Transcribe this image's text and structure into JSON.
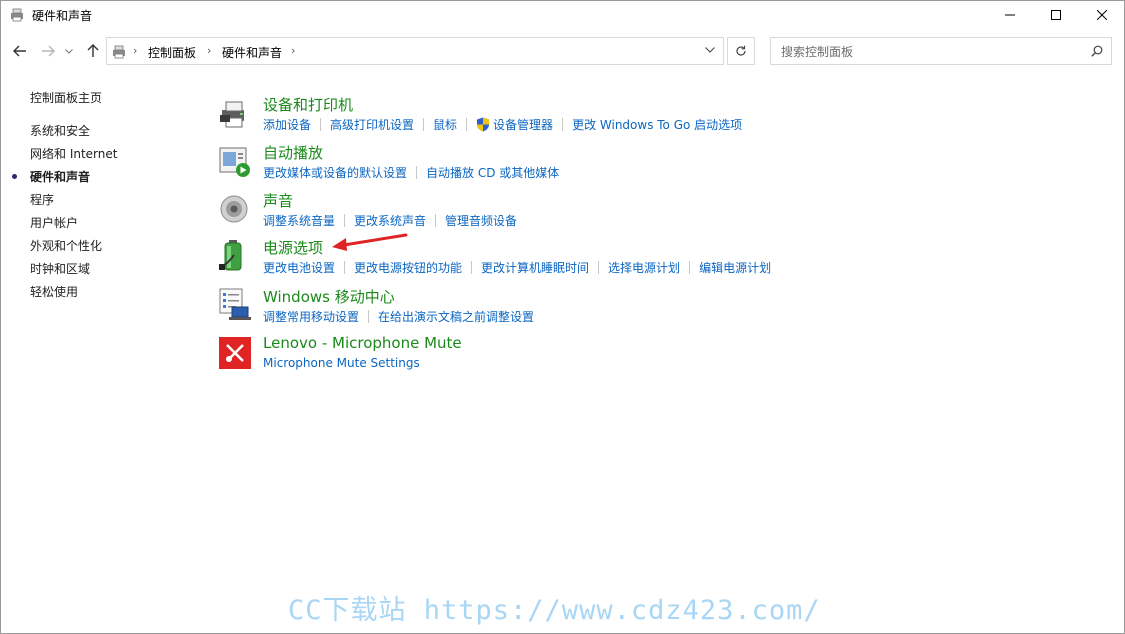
{
  "window": {
    "title": "硬件和声音",
    "controls": {
      "minimize": "minimize",
      "maximize": "maximize",
      "close": "close"
    }
  },
  "address_bar": {
    "crumbs": [
      "控制面板",
      "硬件和声音"
    ]
  },
  "search": {
    "placeholder": "搜索控制面板"
  },
  "left_nav": {
    "items": [
      {
        "label": "控制面板主页"
      },
      {
        "label": "系统和安全"
      },
      {
        "label": "网络和 Internet"
      },
      {
        "label": "硬件和声音",
        "active": true
      },
      {
        "label": "程序"
      },
      {
        "label": "用户帐户"
      },
      {
        "label": "外观和个性化"
      },
      {
        "label": "时钟和区域"
      },
      {
        "label": "轻松使用"
      }
    ]
  },
  "categories": [
    {
      "title": "设备和打印机",
      "icon": "printer-icon",
      "links": [
        "添加设备",
        "高级打印机设置",
        "鼠标",
        "设备管理器",
        "更改 Windows To Go 启动选项"
      ]
    },
    {
      "title": "自动播放",
      "icon": "autoplay-icon",
      "links": [
        "更改媒体或设备的默认设置",
        "自动播放 CD 或其他媒体"
      ]
    },
    {
      "title": "声音",
      "icon": "speaker-icon",
      "links": [
        "调整系统音量",
        "更改系统声音",
        "管理音频设备"
      ]
    },
    {
      "title": "电源选项",
      "icon": "battery-icon",
      "links": [
        "更改电池设置",
        "更改电源按钮的功能",
        "更改计算机睡眠时间",
        "选择电源计划",
        "编辑电源计划"
      ]
    },
    {
      "title": "Windows 移动中心",
      "icon": "mobility-center-icon",
      "links": [
        "调整常用移动设置",
        "在给出演示文稿之前调整设置"
      ]
    },
    {
      "title": "Lenovo - Microphone Mute",
      "icon": "microphone-mute-icon",
      "links": [
        "Microphone Mute Settings"
      ]
    }
  ],
  "watermark": "CC下载站 https://www.cdz423.com/",
  "colors": {
    "heading": "#1a8a1a",
    "link": "#0b66c2",
    "annotation_arrow": "#e02424"
  }
}
